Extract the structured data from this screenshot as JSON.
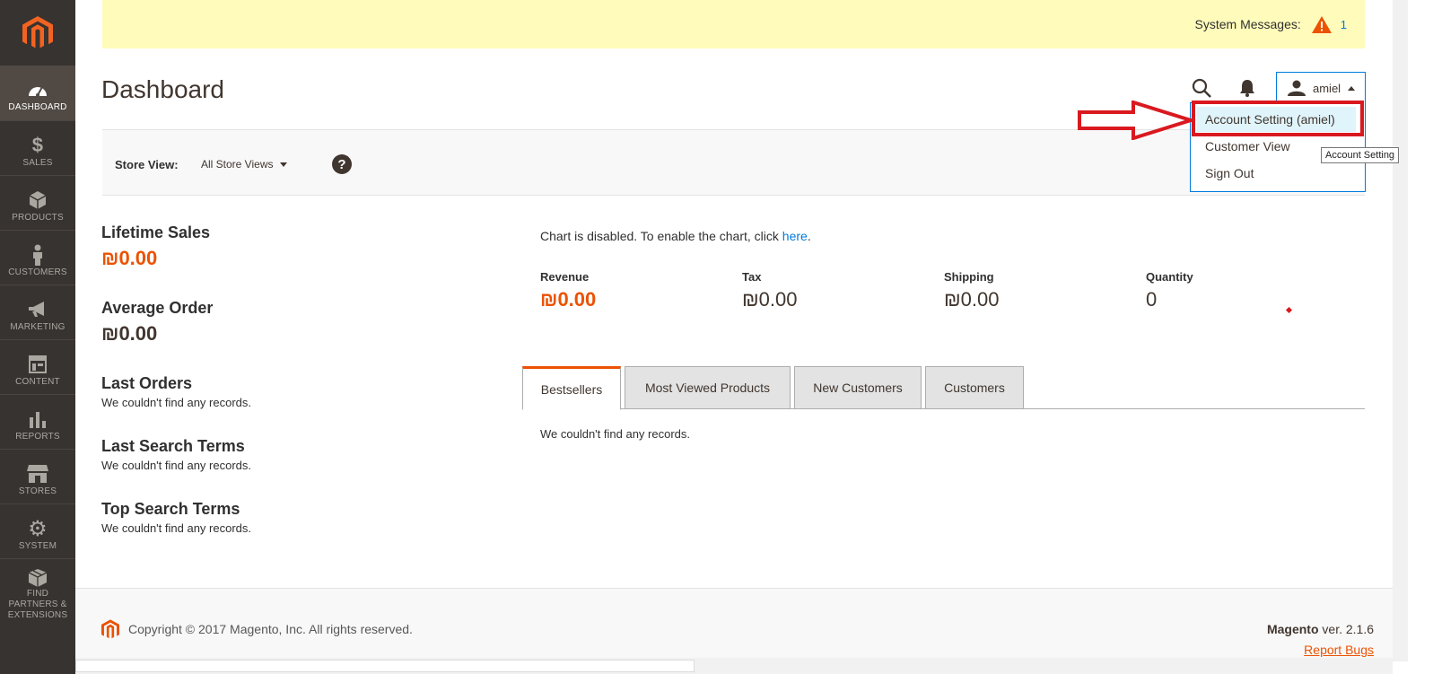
{
  "sidebar": {
    "items": [
      {
        "label": "DASHBOARD",
        "icon": "dashboard-gauge-icon",
        "active": true
      },
      {
        "label": "SALES",
        "icon": "dollar-icon"
      },
      {
        "label": "PRODUCTS",
        "icon": "cube-icon"
      },
      {
        "label": "CUSTOMERS",
        "icon": "person-icon"
      },
      {
        "label": "MARKETING",
        "icon": "megaphone-icon"
      },
      {
        "label": "CONTENT",
        "icon": "layout-icon"
      },
      {
        "label": "REPORTS",
        "icon": "bar-chart-icon"
      },
      {
        "label": "STORES",
        "icon": "storefront-icon"
      },
      {
        "label": "SYSTEM",
        "icon": "gear-icon"
      },
      {
        "label": "FIND PARTNERS & EXTENSIONS",
        "icon": "boxes-icon"
      }
    ]
  },
  "system_messages": {
    "label": "System Messages:",
    "count": "1"
  },
  "header": {
    "title": "Dashboard",
    "user": "amiel",
    "menu": [
      "Account Setting (amiel)",
      "Customer View",
      "Sign Out"
    ],
    "tooltip": "Account Setting"
  },
  "store_view": {
    "label": "Store View:",
    "value": "All Store Views",
    "help": "?"
  },
  "left": {
    "lifetime_sales": {
      "label": "Lifetime Sales",
      "value": "₪0.00"
    },
    "average_order": {
      "label": "Average Order",
      "value": "₪0.00"
    },
    "last_orders": {
      "label": "Last Orders",
      "empty": "We couldn't find any records."
    },
    "last_search_terms": {
      "label": "Last Search Terms",
      "empty": "We couldn't find any records."
    },
    "top_search_terms": {
      "label": "Top Search Terms",
      "empty": "We couldn't find any records."
    }
  },
  "chart": {
    "message": "Chart is disabled. To enable the chart, click ",
    "link": "here",
    "period": "."
  },
  "metrics": [
    {
      "label": "Revenue",
      "value": "₪0.00"
    },
    {
      "label": "Tax",
      "value": "₪0.00"
    },
    {
      "label": "Shipping",
      "value": "₪0.00"
    },
    {
      "label": "Quantity",
      "value": "0"
    }
  ],
  "tabs": [
    "Bestsellers",
    "Most Viewed Products",
    "New Customers",
    "Customers"
  ],
  "tab_content": "We couldn't find any records.",
  "footer": {
    "copyright": "Copyright © 2017 Magento, Inc. All rights reserved.",
    "brand": "Magento",
    "version": " ver. 2.1.6",
    "report_bugs": "Report Bugs"
  },
  "colors": {
    "accent": "#eb5202",
    "link": "#007bdb",
    "sidebar": "#373330",
    "highlight": "#d9191f"
  }
}
